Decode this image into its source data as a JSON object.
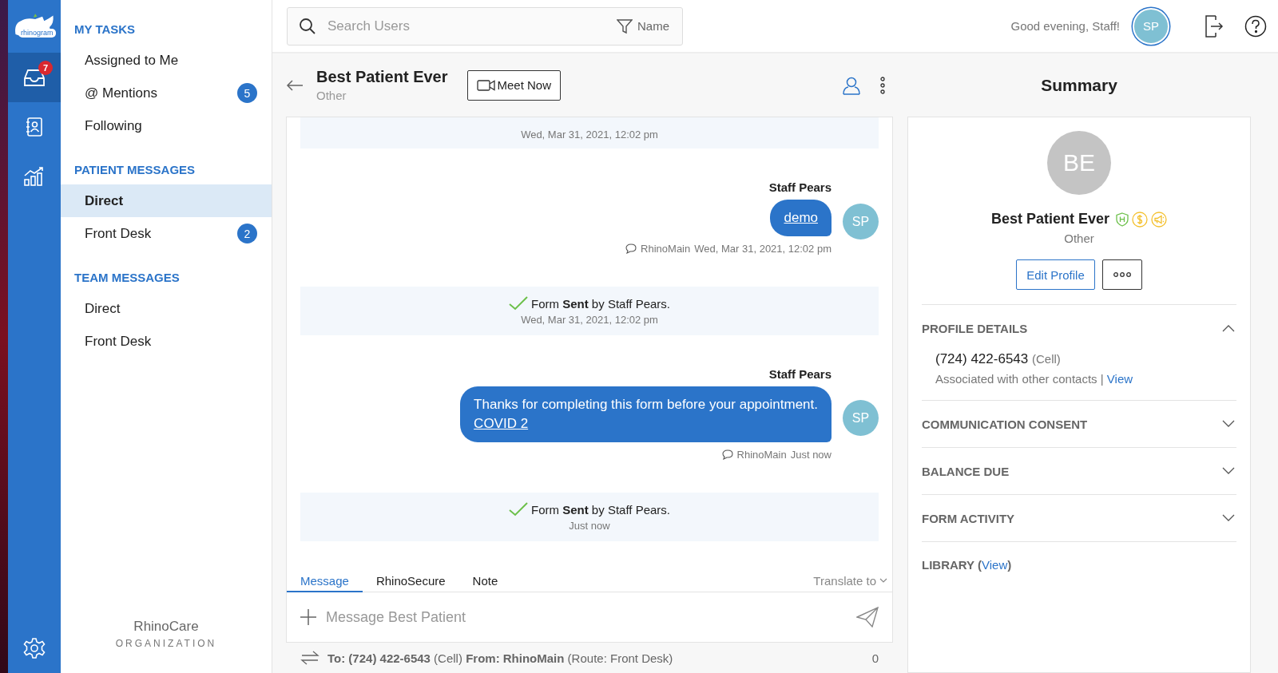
{
  "nav": {
    "logo_text": "rhinogram",
    "items": [
      {
        "kind": "inbox",
        "selected": true,
        "badge": "7"
      },
      {
        "kind": "contacts",
        "selected": false
      },
      {
        "kind": "analytics",
        "selected": false
      }
    ],
    "settings": {
      "kind": "settings"
    }
  },
  "sidebar": {
    "sections": [
      {
        "title": "MY TASKS",
        "items": [
          {
            "label": "Assigned to Me",
            "selected": false
          },
          {
            "label": "@ Mentions",
            "count": "5",
            "selected": false
          },
          {
            "label": "Following",
            "selected": false
          }
        ]
      },
      {
        "title": "PATIENT MESSAGES",
        "items": [
          {
            "label": "Direct",
            "selected": true
          },
          {
            "label": "Front Desk",
            "count": "2",
            "selected": false
          }
        ]
      },
      {
        "title": "TEAM MESSAGES",
        "items": [
          {
            "label": "Direct",
            "selected": false
          },
          {
            "label": "Front Desk",
            "selected": false
          }
        ]
      }
    ],
    "org": {
      "name": "RhinoCare",
      "subtitle": "ORGANIZATION"
    }
  },
  "topbar": {
    "search": {
      "placeholder": "Search Users"
    },
    "filter": "Name",
    "greeting": "Good evening, Staff!",
    "avatar": "SP"
  },
  "conversation": {
    "name": "Best Patient Ever",
    "subtitle": "Other",
    "meet_button": "Meet Now",
    "messages": [
      {
        "kind": "event",
        "time": "Wed, Mar 31, 2021, 12:02 pm"
      },
      {
        "kind": "message",
        "sender": "Staff Pears",
        "link": "demo",
        "channel": "RhinoMain",
        "time": "Wed, Mar 31, 2021, 12:02 pm",
        "avatar": "SP"
      },
      {
        "kind": "event",
        "text": "Form **Sent** by Staff Pears.",
        "time": "Wed, Mar 31, 2021, 12:02 pm"
      },
      {
        "kind": "message",
        "sender": "Staff Pears",
        "body": "Thanks for completing this form before your appointment.",
        "link": "COVID 2",
        "channel": "RhinoMain",
        "time": "Just now",
        "avatar": "SP"
      },
      {
        "kind": "event",
        "text": "Form **Sent** by Staff Pears.",
        "time": "Just now"
      }
    ],
    "compose": {
      "tabs": [
        {
          "label": "Message",
          "selected": true
        },
        {
          "label": "RhinoSecure",
          "selected": false
        },
        {
          "label": "Note",
          "selected": false
        }
      ],
      "translate": "Translate to",
      "placeholder": "Message Best Patient"
    },
    "route": "**To: (724) 422-6543** (Cell) **From: RhinoMain** (Route: Front Desk)",
    "char_count": "0"
  },
  "summary": {
    "title": "Summary",
    "initials": "BE",
    "name": "Best Patient Ever",
    "subtitle": "Other",
    "edit_button": "Edit Profile",
    "sections": [
      {
        "title": "PROFILE DETAILS",
        "expanded": true,
        "phone": "(724) 422-6543",
        "phone_type": "(Cell)",
        "note": "Associated with other contacts |",
        "link": "View"
      },
      {
        "title": "COMMUNICATION CONSENT",
        "expanded": false
      },
      {
        "title": "BALANCE DUE",
        "expanded": false
      },
      {
        "title": "FORM ACTIVITY",
        "expanded": false
      }
    ],
    "library": {
      "label": "LIBRARY (",
      "link": "View",
      "suffix": ")"
    }
  }
}
